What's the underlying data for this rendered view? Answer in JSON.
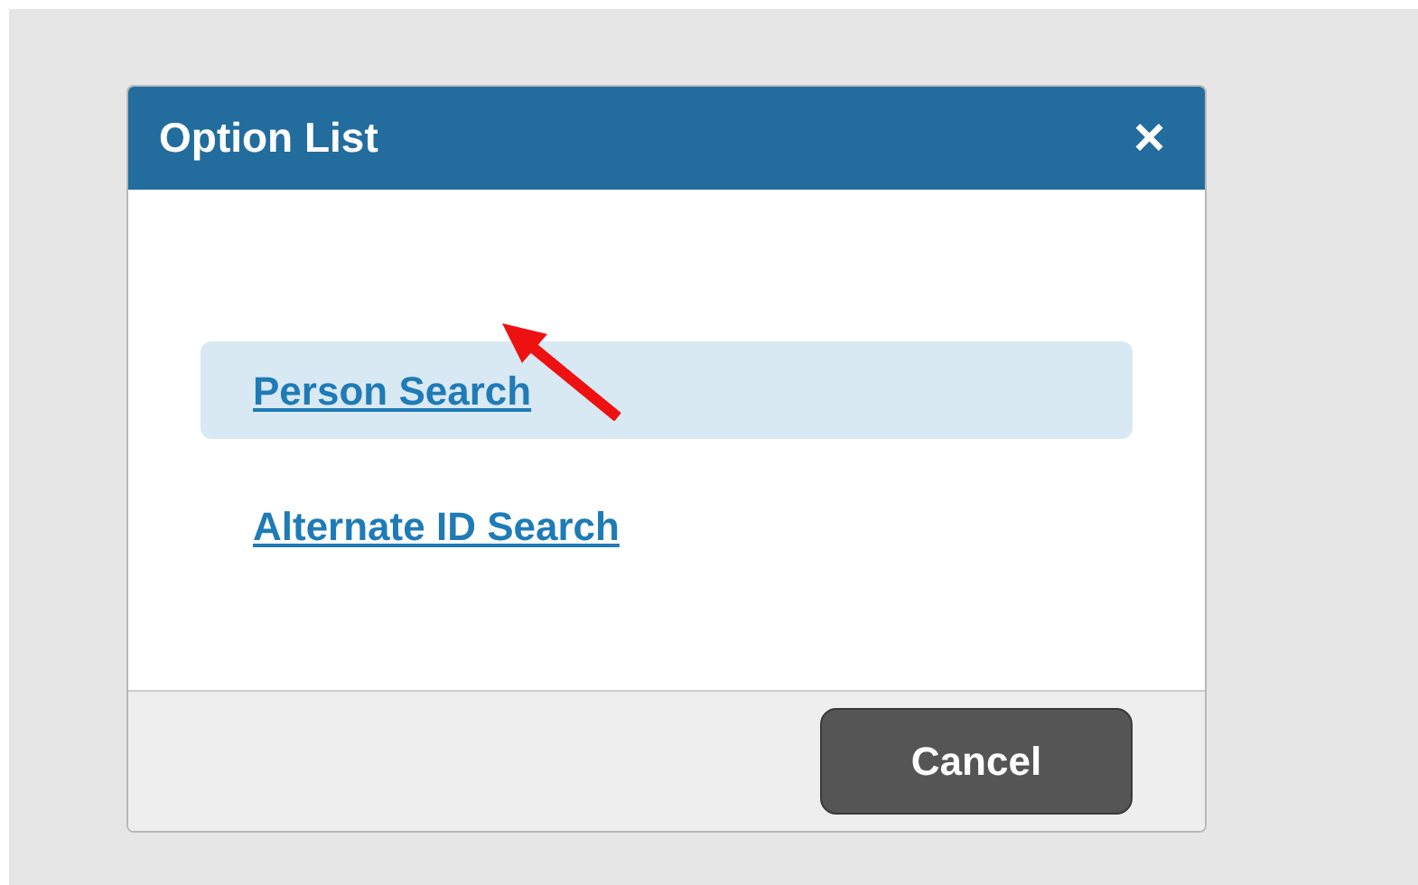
{
  "dialog": {
    "title": "Option List",
    "close": "×",
    "options": [
      {
        "label": "Person Search",
        "selected": true
      },
      {
        "label": "Alternate ID Search",
        "selected": false
      }
    ],
    "buttons": [
      "Cancel"
    ]
  }
}
